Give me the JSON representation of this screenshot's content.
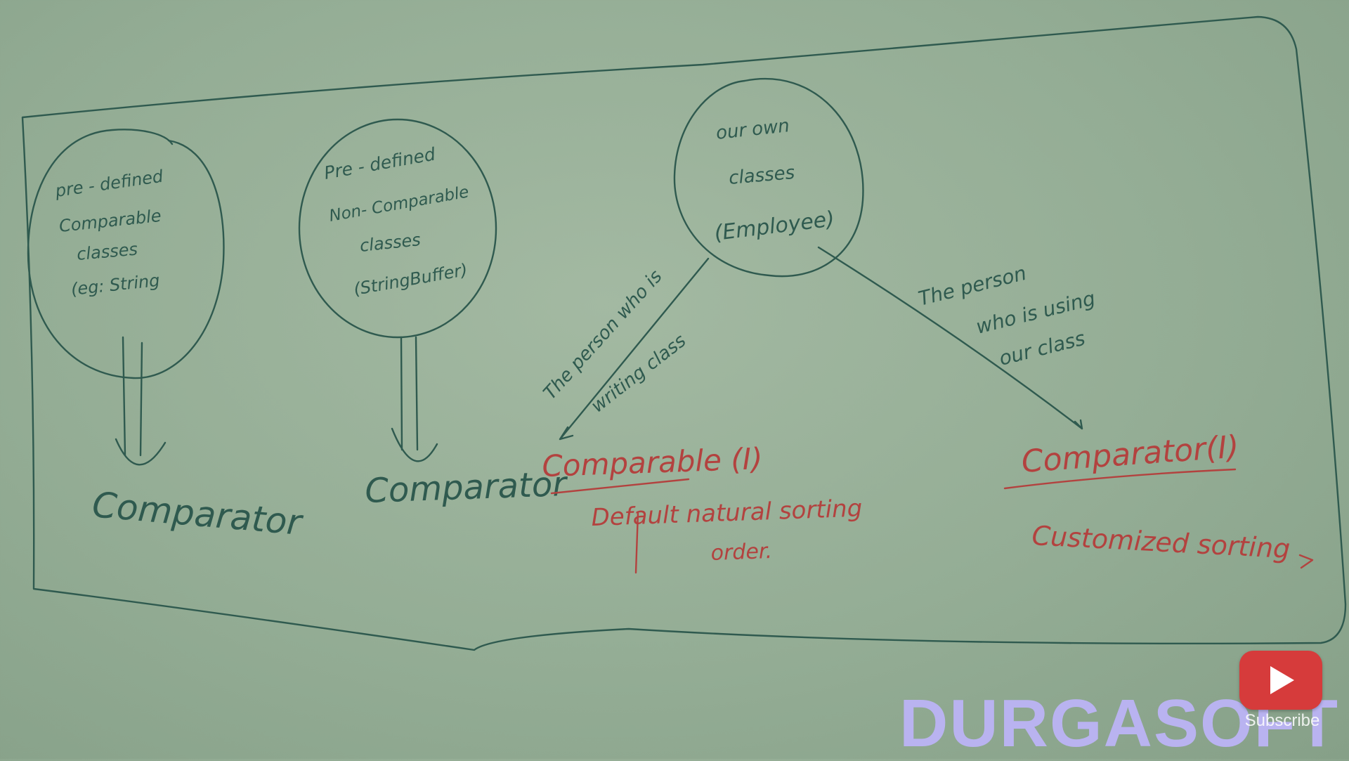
{
  "board": {
    "node_left": {
      "lines": [
        "pre - defined",
        "Comparable",
        "classes",
        "(eg: String"
      ]
    },
    "node_middle": {
      "lines": [
        "Pre - defined",
        "Non- Comparable",
        "classes",
        "(StringBuffer)"
      ]
    },
    "node_right": {
      "lines": [
        "our own",
        "classes",
        "(Employee)"
      ]
    },
    "label_left": "Comparator",
    "label_middle": "Comparator",
    "edge_writer": {
      "lines": [
        "The person who is",
        "writing class"
      ]
    },
    "edge_user": {
      "lines": [
        "The person",
        "who is using",
        "our class"
      ]
    },
    "target_comparable": {
      "title": "Comparable (I)",
      "desc": [
        "Default natural sorting",
        "order."
      ]
    },
    "target_comparator": {
      "title": "Comparator(I)",
      "desc": "Customized sorting"
    }
  },
  "overlay": {
    "watermark": "DURGASOFT",
    "subscribe": "Subscribe",
    "subscribe_icon": "youtube-play-icon"
  },
  "colors": {
    "board": "#94ad95",
    "green_ink": "#2f5a4f",
    "red_ink": "#b3423f",
    "watermark": "#b9b3f0",
    "youtube": "#d63b3b"
  }
}
